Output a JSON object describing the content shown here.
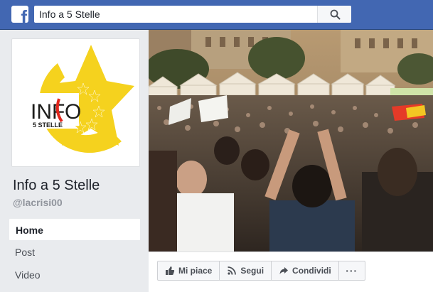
{
  "topbar": {
    "logo_letter": "f",
    "search_value": "Info a 5 Stelle",
    "search_icon": "search-icon"
  },
  "page": {
    "name": "Info a 5 Stelle",
    "handle": "@lacrisi00",
    "profile_logo": {
      "word_info_1": "INF",
      "word_info_2": "O",
      "subtitle": "5 STELLE"
    }
  },
  "nav": {
    "items": [
      {
        "label": "Home",
        "active": true
      },
      {
        "label": "Post",
        "active": false
      },
      {
        "label": "Video",
        "active": false
      }
    ]
  },
  "actions": {
    "like": "Mi piace",
    "follow": "Segui",
    "share": "Condividi",
    "more": "···"
  },
  "colors": {
    "fb_blue": "#4267b2",
    "logo_yellow": "#f5d21e",
    "logo_red": "#e1261c"
  }
}
